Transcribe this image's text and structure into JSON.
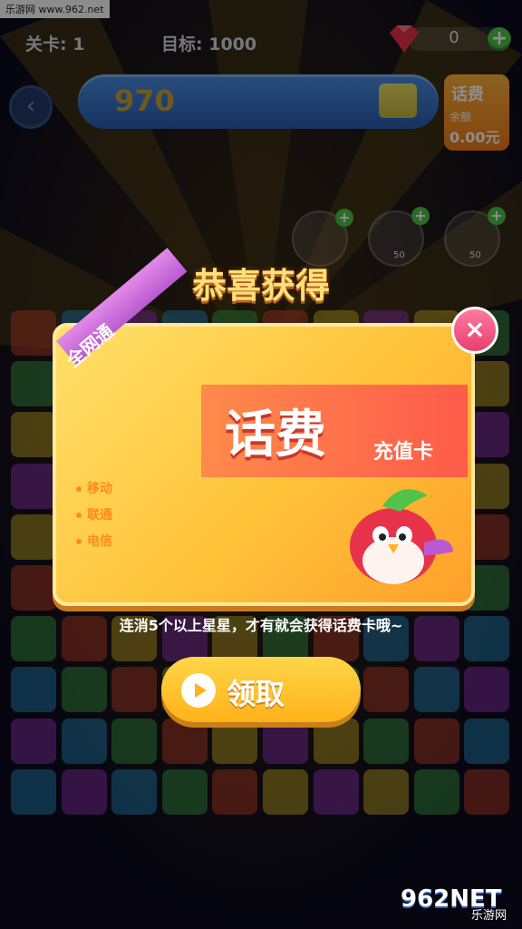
{
  "watermark": "乐游网 www.962.net",
  "top": {
    "level_label": "关卡:",
    "level_value": "1",
    "goal_label": "目标:",
    "goal_value": "1000",
    "gems": "0",
    "plus": "+"
  },
  "score": "970",
  "back_glyph": "‹",
  "phone_card": {
    "title": "话费",
    "balance_label": "余额",
    "balance_value": "0.00元"
  },
  "tools": [
    {
      "cost": "50"
    },
    {
      "cost": "50"
    }
  ],
  "popup": {
    "title": "恭喜获得",
    "ribbon": "全网通",
    "banner_main": "话费",
    "banner_sub": "充值卡",
    "carriers": [
      "移动",
      "联通",
      "电信"
    ],
    "close": "×",
    "hint": "连消5个以上星星，才有就会获得话费卡哦~",
    "claim": "领取"
  },
  "brand": {
    "name": "962NET",
    "sub": "乐游网"
  },
  "colors": {
    "cell_colors": [
      "#d8492e",
      "#2a9ad6",
      "#e8c22a",
      "#3fb04a",
      "#a63ad0",
      "#d8492e",
      "#e8c22a",
      "#2a9ad6",
      "#3fb04a",
      "#a63ad0"
    ]
  }
}
